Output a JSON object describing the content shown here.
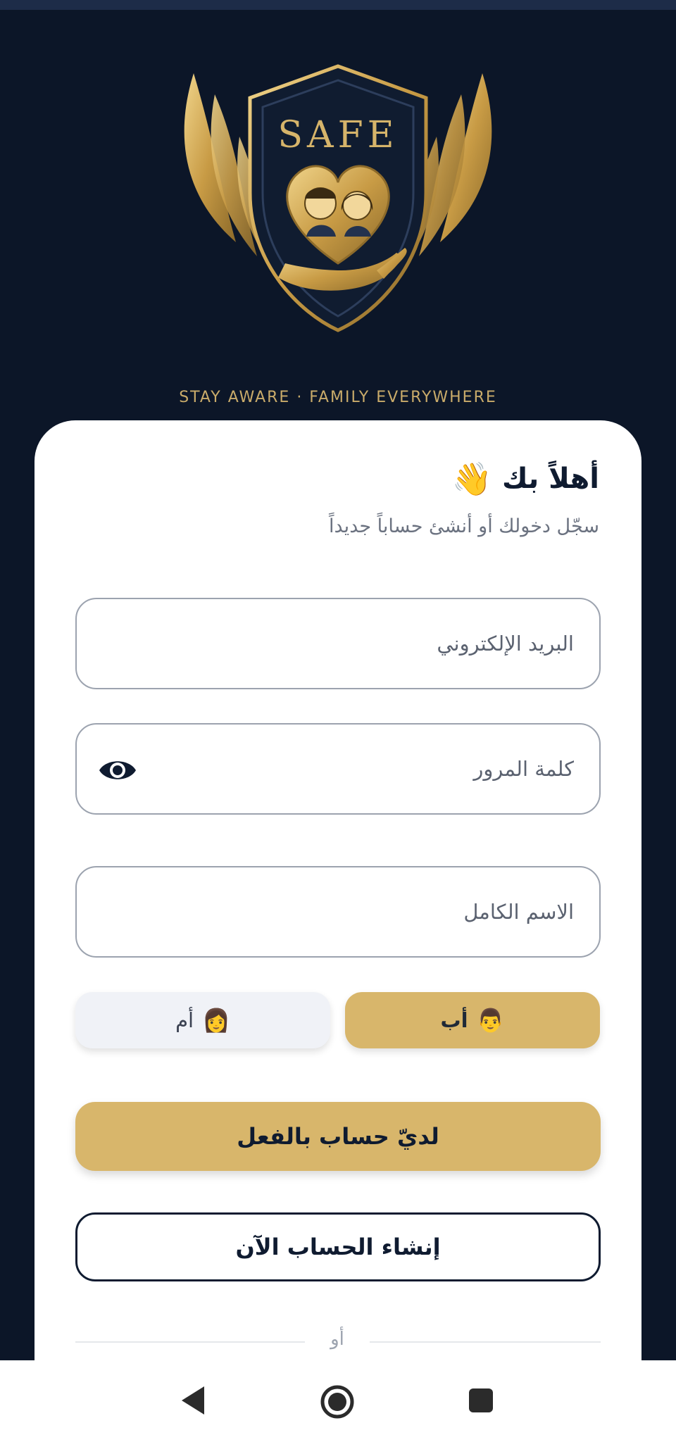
{
  "logo": {
    "brand_text": "SAFE",
    "tagline": "STAY AWARE · FAMILY EVERYWHERE"
  },
  "welcome": {
    "title": "أهلاً بك",
    "title_icon": "👋",
    "subtitle": "سجّل دخولك أو أنشئ حساباً جديداً"
  },
  "form": {
    "email_placeholder": "البريد الإلكتروني",
    "email_value": "",
    "password_placeholder": "كلمة المرور",
    "password_value": "",
    "password_toggle_icon": "eye-icon",
    "fullname_placeholder": "الاسم الكامل",
    "fullname_value": ""
  },
  "roles": {
    "father": {
      "label": "أب",
      "emoji": "👨",
      "selected": true
    },
    "mother": {
      "label": "أم",
      "emoji": "👩",
      "selected": false
    }
  },
  "actions": {
    "login_label": "لديّ حساب بالفعل",
    "create_label": "إنشاء الحساب الآن",
    "divider_text": "أو"
  },
  "navbar": {
    "back_icon": "back-triangle-icon",
    "home_icon": "home-circle-icon",
    "recents_icon": "recents-square-icon"
  },
  "colors": {
    "background": "#0c1628",
    "gold": "#d8b66b",
    "navy": "#0f1b30",
    "card": "#ffffff"
  }
}
